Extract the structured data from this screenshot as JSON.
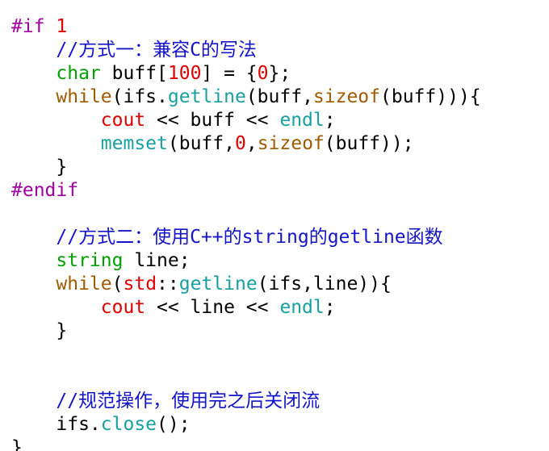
{
  "code_lines": [
    [
      {
        "t": "#if ",
        "c": "pre"
      },
      {
        "t": "1",
        "c": "num"
      }
    ],
    [
      {
        "t": "    ",
        "c": "pl"
      },
      {
        "t": "//方式一：兼容C的写法",
        "c": "com"
      }
    ],
    [
      {
        "t": "    ",
        "c": "pl"
      },
      {
        "t": "char",
        "c": "typ"
      },
      {
        "t": " buff[",
        "c": "pl"
      },
      {
        "t": "100",
        "c": "num"
      },
      {
        "t": "] = {",
        "c": "pl"
      },
      {
        "t": "0",
        "c": "num"
      },
      {
        "t": "};",
        "c": "pl"
      }
    ],
    [
      {
        "t": "    ",
        "c": "pl"
      },
      {
        "t": "while",
        "c": "kw"
      },
      {
        "t": "(ifs.",
        "c": "pl"
      },
      {
        "t": "getline",
        "c": "fn"
      },
      {
        "t": "(buff,",
        "c": "pl"
      },
      {
        "t": "sizeof",
        "c": "kw"
      },
      {
        "t": "(buff))){",
        "c": "pl"
      }
    ],
    [
      {
        "t": "        ",
        "c": "pl"
      },
      {
        "t": "cout",
        "c": "id"
      },
      {
        "t": " << buff << ",
        "c": "pl"
      },
      {
        "t": "endl",
        "c": "fn"
      },
      {
        "t": ";",
        "c": "pl"
      }
    ],
    [
      {
        "t": "        ",
        "c": "pl"
      },
      {
        "t": "memset",
        "c": "fn"
      },
      {
        "t": "(buff,",
        "c": "pl"
      },
      {
        "t": "0",
        "c": "num"
      },
      {
        "t": ",",
        "c": "pl"
      },
      {
        "t": "sizeof",
        "c": "kw"
      },
      {
        "t": "(buff));",
        "c": "pl"
      }
    ],
    [
      {
        "t": "    }",
        "c": "pl"
      }
    ],
    [
      {
        "t": "#endif",
        "c": "pre"
      }
    ],
    [],
    [
      {
        "t": "    ",
        "c": "pl"
      },
      {
        "t": "//方式二：使用C++的string的getline函数",
        "c": "com"
      }
    ],
    [
      {
        "t": "    ",
        "c": "pl"
      },
      {
        "t": "string",
        "c": "typ"
      },
      {
        "t": " line;",
        "c": "pl"
      }
    ],
    [
      {
        "t": "    ",
        "c": "pl"
      },
      {
        "t": "while",
        "c": "kw"
      },
      {
        "t": "(",
        "c": "pl"
      },
      {
        "t": "std",
        "c": "id"
      },
      {
        "t": "::",
        "c": "pl"
      },
      {
        "t": "getline",
        "c": "fn"
      },
      {
        "t": "(ifs,line)){",
        "c": "pl"
      }
    ],
    [
      {
        "t": "        ",
        "c": "pl"
      },
      {
        "t": "cout",
        "c": "id"
      },
      {
        "t": " << line << ",
        "c": "pl"
      },
      {
        "t": "endl",
        "c": "fn"
      },
      {
        "t": ";",
        "c": "pl"
      }
    ],
    [
      {
        "t": "    }",
        "c": "pl"
      }
    ],
    [],
    [],
    [
      {
        "t": "    ",
        "c": "pl"
      },
      {
        "t": "//规范操作，使用完之后关闭流",
        "c": "com"
      }
    ],
    [
      {
        "t": "    ",
        "c": "pl"
      },
      {
        "t": "ifs.",
        "c": "pl"
      },
      {
        "t": "close",
        "c": "fn"
      },
      {
        "t": "();",
        "c": "pl"
      }
    ],
    [
      {
        "t": "}",
        "c": "pl"
      }
    ]
  ]
}
